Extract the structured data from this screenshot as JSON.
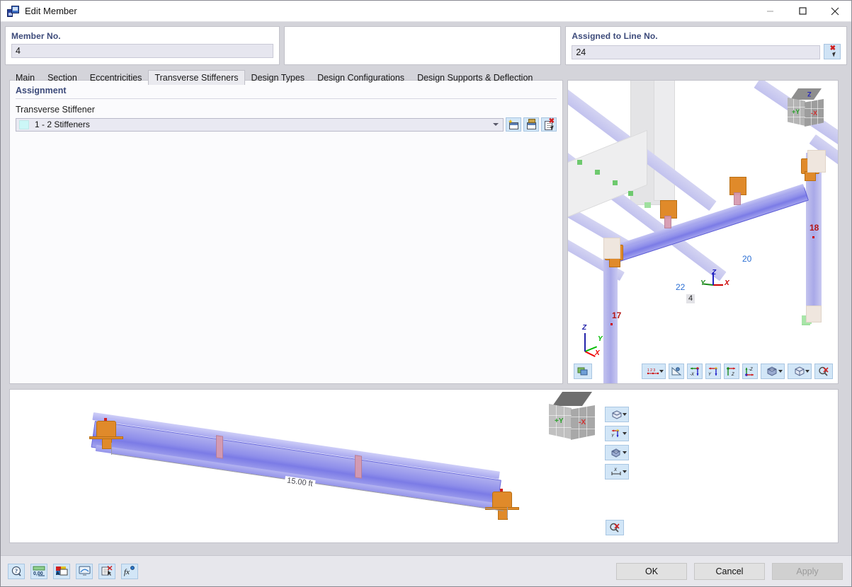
{
  "window": {
    "title": "Edit Member",
    "icon": "edit-member-icon",
    "minimize": "—",
    "maximize": "☐",
    "close": "✕"
  },
  "header": {
    "member": {
      "label": "Member No.",
      "value": "4"
    },
    "middle": {
      "label": "",
      "value": ""
    },
    "line": {
      "label": "Assigned to Line No.",
      "value": "24",
      "pick_button": "select-line-icon"
    }
  },
  "tabs": [
    {
      "label": "Main",
      "active": false
    },
    {
      "label": "Section",
      "active": false
    },
    {
      "label": "Eccentricities",
      "active": false
    },
    {
      "label": "Transverse Stiffeners",
      "active": true
    },
    {
      "label": "Design Types",
      "active": false
    },
    {
      "label": "Design Configurations",
      "active": false
    },
    {
      "label": "Design Supports & Deflection",
      "active": false
    }
  ],
  "assignment": {
    "section_title": "Assignment",
    "field_label": "Transverse Stiffener",
    "selected": {
      "swatch_color": "#ccf7f7",
      "text": "1 - 2 Stiffeners"
    },
    "buttons": [
      {
        "name": "new-stiffener-button",
        "icon": "new-window-star-icon"
      },
      {
        "name": "edit-stiffener-button",
        "icon": "edit-window-tool-icon"
      },
      {
        "name": "delete-stiffener-button",
        "icon": "delete-selection-icon"
      }
    ]
  },
  "viewport3d": {
    "labels": {
      "node_17": "17",
      "node_18": "18",
      "node_20": "20",
      "node_22": "22",
      "member_4": "4"
    },
    "axes": {
      "x": "X",
      "y": "Y",
      "z": "Z"
    },
    "navcube": {
      "front": "-X",
      "left": "+Y",
      "top": "Z"
    },
    "toolbar": [
      {
        "name": "render-mode-button",
        "icon": "render-shading-icon"
      },
      {
        "name": "numbering-dropdown",
        "icon": "numbering-123-icon"
      },
      {
        "name": "measure-button",
        "icon": "ruler-protractor-icon"
      },
      {
        "name": "view-x-button",
        "icon": "view-minus-x-icon",
        "label": "-X"
      },
      {
        "name": "view-y-button",
        "icon": "view-y-icon",
        "label": "Y"
      },
      {
        "name": "view-z-button",
        "icon": "view-y-z-icon",
        "label": "Z"
      },
      {
        "name": "view-iso-button",
        "icon": "view-z-iso-icon",
        "label": "-Z"
      },
      {
        "name": "display-mode-dropdown",
        "icon": "solid-model-icon"
      },
      {
        "name": "projection-dropdown",
        "icon": "wireframe-cube-icon"
      },
      {
        "name": "zoom-reset-button",
        "icon": "zoom-reset-icon"
      }
    ]
  },
  "memberview": {
    "dimension": "15.00 ft",
    "navcube": {
      "front": "-X",
      "left": "+Y"
    },
    "toolbar": [
      {
        "name": "projection-dropdown",
        "icon": "wireframe-cube-icon"
      },
      {
        "name": "axis-view-dropdown",
        "icon": "axis-y-icon"
      },
      {
        "name": "render-mode-dropdown",
        "icon": "solid-model-icon"
      },
      {
        "name": "dimension-dropdown",
        "icon": "dimension-x-icon"
      }
    ],
    "zoom_button": {
      "name": "zoom-reset-button",
      "icon": "zoom-reset-icon"
    }
  },
  "statusbar": {
    "icons": [
      {
        "name": "help-button",
        "icon": "help-question-icon"
      },
      {
        "name": "decimal-places-button",
        "icon": "decimal-places-icon"
      },
      {
        "name": "units-button",
        "icon": "units-label-icon"
      },
      {
        "name": "display-properties-button",
        "icon": "display-monitor-icon"
      },
      {
        "name": "clear-selection-button",
        "icon": "clear-selection-icon"
      },
      {
        "name": "formula-button",
        "icon": "function-fx-icon"
      }
    ],
    "buttons": {
      "ok": "OK",
      "cancel": "Cancel",
      "apply": "Apply",
      "apply_disabled": true
    }
  },
  "colors": {
    "accent_label": "#3c4a7a",
    "field_bg": "#e6e6ef",
    "icon_btn_bg": "#d2e6f7",
    "beam": "#8e8eea",
    "support": "#e08a2a",
    "stiffener": "#d69ab0",
    "node_red": "#b41616",
    "node_blue": "#2b6fd4"
  }
}
